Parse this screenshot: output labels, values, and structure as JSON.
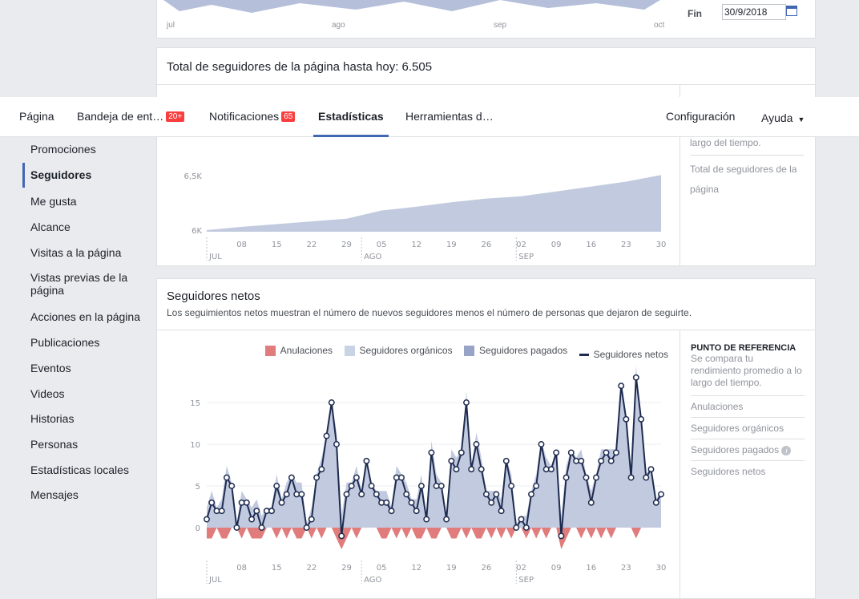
{
  "top_chart": {
    "month_labels": [
      "jul",
      "ago",
      "sep",
      "oct"
    ],
    "end_label": "Fin",
    "end_date": "30/9/2018"
  },
  "total_header": "Total de seguidores de la página hasta hoy: 6.505",
  "nav": {
    "items": [
      {
        "label": "Página"
      },
      {
        "label": "Bandeja de ent…",
        "badge": "20+"
      },
      {
        "label": "Notificaciones",
        "badge": "65"
      },
      {
        "label": "Estadísticas",
        "active": true
      },
      {
        "label": "Herramientas d…"
      }
    ],
    "right": {
      "settings": "Configuración",
      "help": "Ayuda"
    }
  },
  "sidebar": {
    "items": [
      "Promociones",
      "Seguidores",
      "Me gusta",
      "Alcance",
      "Visitas a la página",
      "Vistas previas de la página",
      "Acciones en la página",
      "Publicaciones",
      "Eventos",
      "Videos",
      "Historias",
      "Personas",
      "Estadísticas locales",
      "Mensajes"
    ],
    "active": "Seguidores"
  },
  "total_panel": {
    "side_text": "largo del tiempo.",
    "side_link": "Total de seguidores de la página"
  },
  "net_card": {
    "title": "Seguidores netos",
    "description": "Los seguimientos netos muestran el número de nuevos seguidores menos el número de personas que dejaron de seguirte.",
    "reference": {
      "heading": "PUNTO DE REFERENCIA",
      "text": "Se compara tu rendimiento promedio a lo largo del tiempo.",
      "links": [
        "Anulaciones",
        "Seguidores orgánicos",
        "Seguidores pagados",
        "Seguidores netos"
      ]
    }
  },
  "colors": {
    "unfollows": "#e07c7c",
    "organic": "#c9d3e6",
    "paid": "#97a4c8",
    "net": "#1d2b4f",
    "accent": "#4267b2"
  },
  "chart_data": [
    {
      "type": "area",
      "title": "",
      "x_tick_labels": [
        "08",
        "15",
        "22",
        "29",
        "05",
        "12",
        "19",
        "26",
        "02",
        "09",
        "16",
        "23",
        "30"
      ],
      "month_labels": [
        "JUL",
        "AGO",
        "SEP"
      ],
      "y_tick_labels": [
        "6K",
        "6,5K"
      ],
      "ylim": [
        5980,
        6560
      ],
      "x": [
        "2018-07-01",
        "2018-07-08",
        "2018-07-15",
        "2018-07-22",
        "2018-07-29",
        "2018-08-05",
        "2018-08-12",
        "2018-08-19",
        "2018-08-26",
        "2018-09-02",
        "2018-09-09",
        "2018-09-16",
        "2018-09-23",
        "2018-09-30"
      ],
      "series": [
        {
          "values": [
            6000,
            6030,
            6055,
            6080,
            6105,
            6180,
            6215,
            6255,
            6290,
            6310,
            6355,
            6400,
            6445,
            6505
          ]
        }
      ]
    },
    {
      "type": "area",
      "title": "Seguidores netos",
      "legend": [
        "Anulaciones",
        "Seguidores orgánicos",
        "Seguidores pagados",
        "Seguidores netos"
      ],
      "legend_position": "top-right",
      "x_tick_labels": [
        "08",
        "15",
        "22",
        "29",
        "05",
        "12",
        "19",
        "26",
        "02",
        "09",
        "16",
        "23",
        "30"
      ],
      "month_labels": [
        "JUL",
        "AGO",
        "SEP"
      ],
      "y_tick_labels": [
        "0",
        "5",
        "10",
        "15"
      ],
      "ylim": [
        -3,
        18.5
      ],
      "x_start": "2018-07-01",
      "x_end": "2018-09-30",
      "series": [
        {
          "name": "Seguidores netos",
          "values": [
            1,
            3,
            2,
            2,
            6,
            5,
            0,
            3,
            3,
            1,
            2,
            0,
            2,
            2,
            5,
            3,
            4,
            6,
            4,
            4,
            0,
            1,
            6,
            7,
            11,
            15,
            10,
            -1,
            4,
            5,
            6,
            4,
            8,
            5,
            4,
            3,
            3,
            2,
            6,
            6,
            4,
            3,
            2,
            5,
            1,
            9,
            5,
            5,
            1,
            8,
            7,
            9,
            15,
            7,
            10,
            7,
            4,
            3,
            4,
            2,
            8,
            5,
            0,
            1,
            0,
            4,
            5,
            10,
            7,
            7,
            9,
            -1,
            6,
            9,
            8,
            8,
            6,
            3,
            6,
            8,
            9,
            8,
            9,
            17,
            13,
            6,
            18,
            13,
            6,
            7,
            3,
            4
          ]
        },
        {
          "name": "Anulaciones",
          "values": [
            -1,
            -1,
            0,
            -1,
            -1,
            0,
            0,
            -1,
            0,
            -1,
            -1,
            -1,
            0,
            0,
            -1,
            0,
            -1,
            0,
            -1,
            -1,
            0,
            -1,
            0,
            -1,
            0,
            0,
            -1,
            -2,
            -1,
            0,
            -1,
            0,
            0,
            0,
            0,
            -1,
            -1,
            0,
            -1,
            0,
            -1,
            0,
            -1,
            -1,
            0,
            -1,
            -1,
            0,
            0,
            -1,
            -1,
            0,
            -1,
            0,
            -1,
            -1,
            0,
            -1,
            0,
            -1,
            0,
            -1,
            0,
            0,
            -1,
            0,
            -1,
            0,
            -1,
            0,
            0,
            -2,
            -1,
            0,
            0,
            -1,
            0,
            -1,
            0,
            -1,
            0,
            -1,
            0,
            0,
            0,
            0,
            -1,
            0,
            0,
            0,
            0,
            0
          ]
        }
      ]
    }
  ]
}
